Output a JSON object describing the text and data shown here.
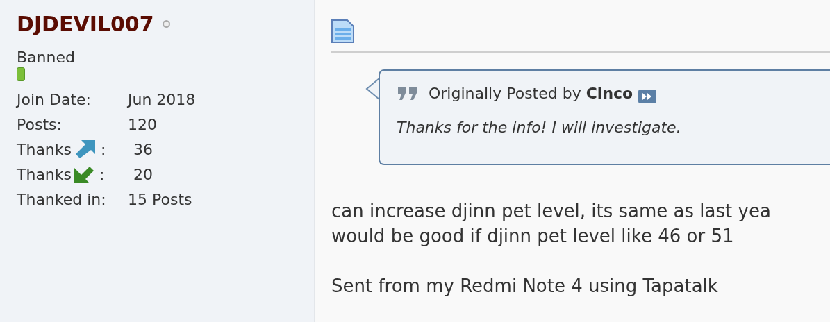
{
  "user": {
    "name": "DJDEVIL007",
    "online": false,
    "rank": "Banned",
    "stats": [
      {
        "kind": "plain",
        "label": "Join Date:",
        "value": "Jun 2018"
      },
      {
        "kind": "plain",
        "label": "Posts:",
        "value": "120"
      },
      {
        "kind": "given",
        "label": "Thanks",
        "separator": ":",
        "value": "36"
      },
      {
        "kind": "received",
        "label": "Thanks",
        "separator": ":",
        "value": "20"
      },
      {
        "kind": "plain",
        "label": "Thanked in:",
        "value": "15 Posts"
      }
    ]
  },
  "post": {
    "quote": {
      "prefix": "Originally Posted by",
      "author": "Cinco",
      "text": "Thanks for the info! I will investigate."
    },
    "paragraphs": [
      [
        "can increase djinn pet level, its same as last yea",
        "would be good if djinn pet level like 46 or 51"
      ],
      [
        "Sent from my Redmi Note 4 using Tapatalk"
      ]
    ]
  }
}
